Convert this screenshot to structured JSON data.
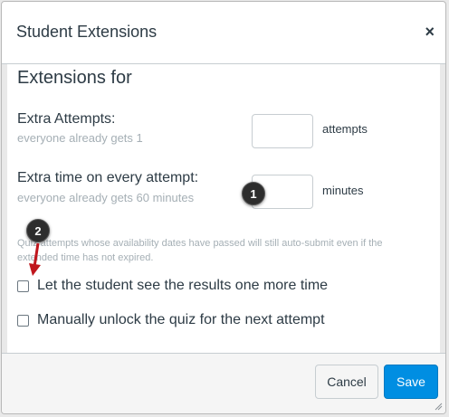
{
  "dialog": {
    "title": "Student Extensions",
    "close_icon": "×"
  },
  "section": {
    "title": "Extensions for"
  },
  "extra_attempts": {
    "label": "Extra Attempts:",
    "hint": "everyone already gets 1",
    "value": "",
    "unit": "attempts"
  },
  "extra_time": {
    "label": "Extra time on every attempt:",
    "hint": "everyone already gets 60 minutes",
    "value": "",
    "unit": "minutes"
  },
  "note": "Quiz attempts whose availability dates have passed will still auto-submit even if the extended time has not expired.",
  "options": [
    {
      "label": "Let the student see the results one more time",
      "checked": false
    },
    {
      "label": "Manually unlock the quiz for the next attempt",
      "checked": false
    }
  ],
  "callouts": [
    "1",
    "2"
  ],
  "footer": {
    "cancel_label": "Cancel",
    "save_label": "Save"
  },
  "colors": {
    "primary": "#008ee2",
    "text": "#2d3b45",
    "muted": "#a5afb5",
    "callout_arrow": "#c0161d"
  }
}
